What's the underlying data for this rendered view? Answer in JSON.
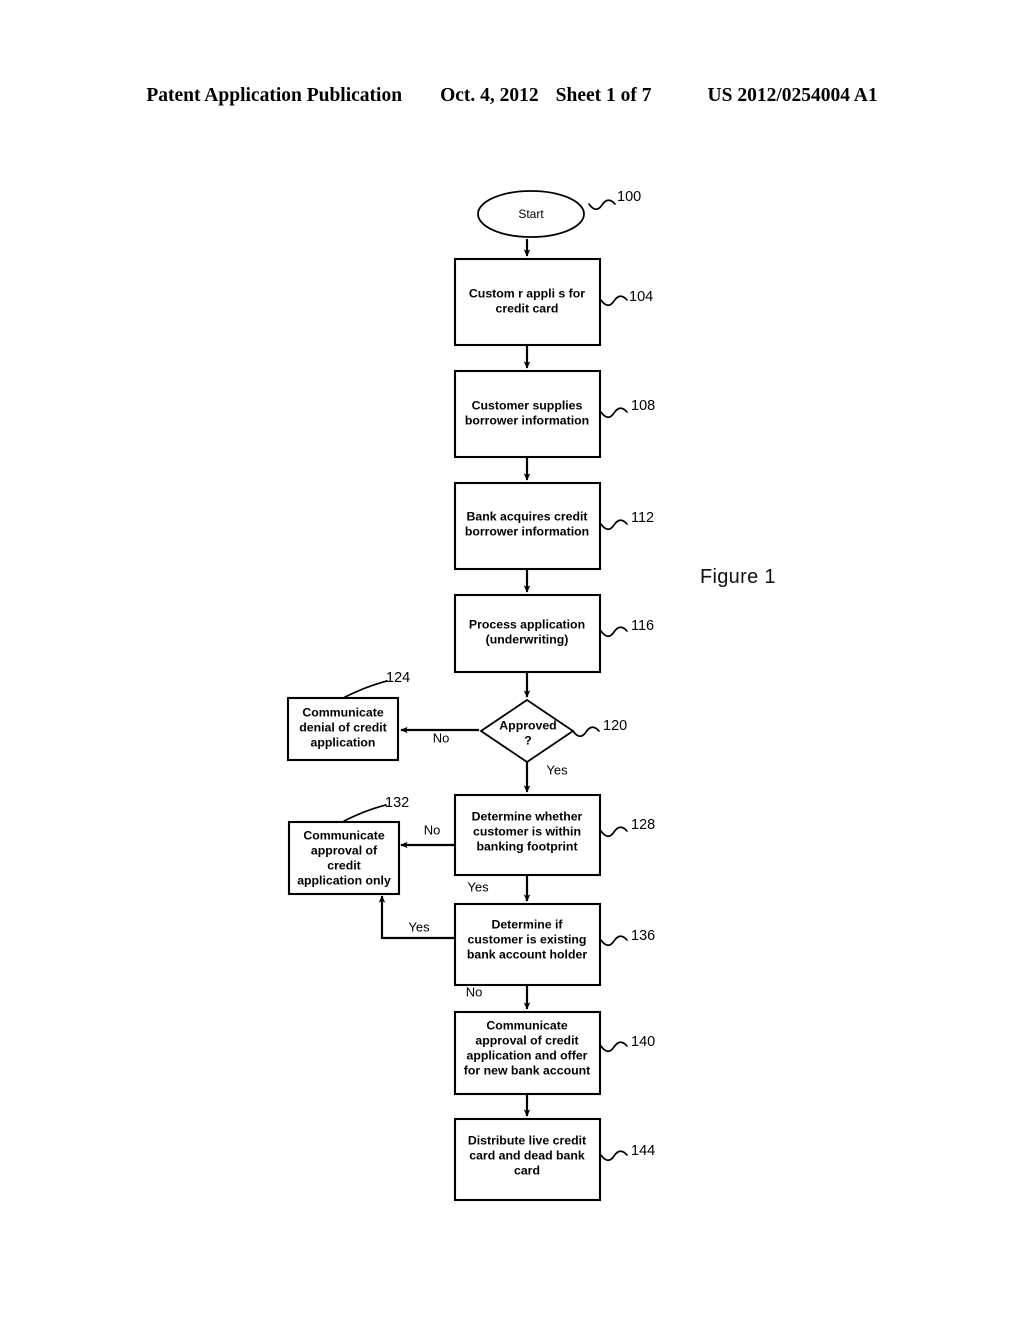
{
  "header": {
    "publication": "Patent Application Publication",
    "date": "Oct. 4, 2012",
    "sheet": "Sheet 1 of 7",
    "number": "US 2012/0254004 A1"
  },
  "figure": {
    "caption": "Figure 1"
  },
  "flowchart": {
    "nodes": [
      {
        "id": "start",
        "ref": "100",
        "shape": "ellipse",
        "lines": [
          "Start"
        ]
      },
      {
        "id": "apply",
        "ref": "104",
        "shape": "rect",
        "lines": [
          "Custom  r appli  s for",
          "credit card"
        ]
      },
      {
        "id": "supplies",
        "ref": "108",
        "shape": "rect",
        "lines": [
          "Customer supplies",
          "borrower information"
        ]
      },
      {
        "id": "acquires",
        "ref": "112",
        "shape": "rect",
        "lines": [
          "Bank acquires credit",
          "borrower information"
        ]
      },
      {
        "id": "process",
        "ref": "116",
        "shape": "rect",
        "lines": [
          "Process application",
          "(underwriting)"
        ]
      },
      {
        "id": "approved",
        "ref": "120",
        "shape": "diamond",
        "lines": [
          "Approved",
          "?"
        ]
      },
      {
        "id": "denial",
        "ref": "124",
        "shape": "rect",
        "lines": [
          "Communicate",
          "denial of credit",
          "application"
        ]
      },
      {
        "id": "footprint",
        "ref": "128",
        "shape": "rect",
        "lines": [
          "Determine whether",
          "customer is within",
          "banking footprint"
        ]
      },
      {
        "id": "approval-only",
        "ref": "132",
        "shape": "rect",
        "lines": [
          "Communicate",
          "approval of",
          "credit",
          "application only"
        ]
      },
      {
        "id": "existing-holder",
        "ref": "136",
        "shape": "rect",
        "lines": [
          "Determine if",
          "customer is existing",
          "bank account holder"
        ]
      },
      {
        "id": "approval-offer",
        "ref": "140",
        "shape": "rect",
        "lines": [
          "Communicate",
          "approval of credit",
          "application and offer",
          "for new bank account"
        ]
      },
      {
        "id": "distribute",
        "ref": "144",
        "shape": "rect",
        "lines": [
          "Distribute live credit",
          "card and dead bank",
          "card"
        ]
      }
    ],
    "edge_labels": {
      "approved_no": "No",
      "approved_yes": "Yes",
      "footprint_no": "No",
      "footprint_yes": "Yes",
      "holder_yes": "Yes",
      "holder_no": "No"
    }
  }
}
